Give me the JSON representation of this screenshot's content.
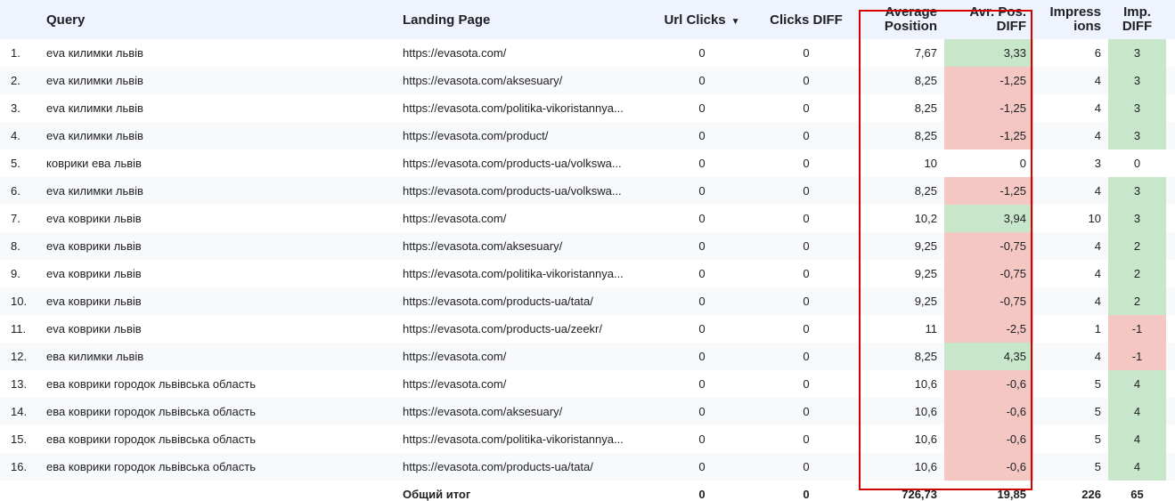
{
  "headers": {
    "query": "Query",
    "landing_page": "Landing Page",
    "url_clicks": "Url Clicks",
    "sort_arrow": "▼",
    "clicks_diff": "Clicks DIFF",
    "avg_position": [
      "Average",
      "Position"
    ],
    "avg_pos_diff": [
      "Avr. Pos.",
      "DIFF"
    ],
    "impressions": [
      "Impress",
      "ions"
    ],
    "imp_diff": [
      "Imp.",
      "DIFF"
    ]
  },
  "rows": [
    {
      "idx": "1.",
      "query": "eva килимки львів",
      "page": "https://evasota.com/",
      "clicks": "0",
      "clicks_diff": "0",
      "avg_pos": "7,67",
      "pos_diff": "3,33",
      "pos_diff_sign": "pos",
      "impr": "6",
      "imp_diff": "3",
      "imp_diff_sign": "pos"
    },
    {
      "idx": "2.",
      "query": "eva килимки львів",
      "page": "https://evasota.com/aksesuary/",
      "clicks": "0",
      "clicks_diff": "0",
      "avg_pos": "8,25",
      "pos_diff": "-1,25",
      "pos_diff_sign": "neg",
      "impr": "4",
      "imp_diff": "3",
      "imp_diff_sign": "pos"
    },
    {
      "idx": "3.",
      "query": "eva килимки львів",
      "page": "https://evasota.com/politika-vikoristannya...",
      "clicks": "0",
      "clicks_diff": "0",
      "avg_pos": "8,25",
      "pos_diff": "-1,25",
      "pos_diff_sign": "neg",
      "impr": "4",
      "imp_diff": "3",
      "imp_diff_sign": "pos"
    },
    {
      "idx": "4.",
      "query": "eva килимки львів",
      "page": "https://evasota.com/product/",
      "clicks": "0",
      "clicks_diff": "0",
      "avg_pos": "8,25",
      "pos_diff": "-1,25",
      "pos_diff_sign": "neg",
      "impr": "4",
      "imp_diff": "3",
      "imp_diff_sign": "pos"
    },
    {
      "idx": "5.",
      "query": "коврики ева львів",
      "page": "https://evasota.com/products-ua/volkswa...",
      "clicks": "0",
      "clicks_diff": "0",
      "avg_pos": "10",
      "pos_diff": "0",
      "pos_diff_sign": "none",
      "impr": "3",
      "imp_diff": "0",
      "imp_diff_sign": "none"
    },
    {
      "idx": "6.",
      "query": "eva килимки львів",
      "page": "https://evasota.com/products-ua/volkswa...",
      "clicks": "0",
      "clicks_diff": "0",
      "avg_pos": "8,25",
      "pos_diff": "-1,25",
      "pos_diff_sign": "neg",
      "impr": "4",
      "imp_diff": "3",
      "imp_diff_sign": "pos"
    },
    {
      "idx": "7.",
      "query": "eva коврики львів",
      "page": "https://evasota.com/",
      "clicks": "0",
      "clicks_diff": "0",
      "avg_pos": "10,2",
      "pos_diff": "3,94",
      "pos_diff_sign": "pos",
      "impr": "10",
      "imp_diff": "3",
      "imp_diff_sign": "pos"
    },
    {
      "idx": "8.",
      "query": "eva коврики львів",
      "page": "https://evasota.com/aksesuary/",
      "clicks": "0",
      "clicks_diff": "0",
      "avg_pos": "9,25",
      "pos_diff": "-0,75",
      "pos_diff_sign": "neg",
      "impr": "4",
      "imp_diff": "2",
      "imp_diff_sign": "pos"
    },
    {
      "idx": "9.",
      "query": "eva коврики львів",
      "page": "https://evasota.com/politika-vikoristannya...",
      "clicks": "0",
      "clicks_diff": "0",
      "avg_pos": "9,25",
      "pos_diff": "-0,75",
      "pos_diff_sign": "neg",
      "impr": "4",
      "imp_diff": "2",
      "imp_diff_sign": "pos"
    },
    {
      "idx": "10.",
      "query": "eva коврики львів",
      "page": "https://evasota.com/products-ua/tata/",
      "clicks": "0",
      "clicks_diff": "0",
      "avg_pos": "9,25",
      "pos_diff": "-0,75",
      "pos_diff_sign": "neg",
      "impr": "4",
      "imp_diff": "2",
      "imp_diff_sign": "pos"
    },
    {
      "idx": "11.",
      "query": "eva коврики львів",
      "page": "https://evasota.com/products-ua/zeekr/",
      "clicks": "0",
      "clicks_diff": "0",
      "avg_pos": "11",
      "pos_diff": "-2,5",
      "pos_diff_sign": "neg",
      "impr": "1",
      "imp_diff": "-1",
      "imp_diff_sign": "neg"
    },
    {
      "idx": "12.",
      "query": "ева килимки львів",
      "page": "https://evasota.com/",
      "clicks": "0",
      "clicks_diff": "0",
      "avg_pos": "8,25",
      "pos_diff": "4,35",
      "pos_diff_sign": "pos",
      "impr": "4",
      "imp_diff": "-1",
      "imp_diff_sign": "neg"
    },
    {
      "idx": "13.",
      "query": "ева коврики городок львівська область",
      "page": "https://evasota.com/",
      "clicks": "0",
      "clicks_diff": "0",
      "avg_pos": "10,6",
      "pos_diff": "-0,6",
      "pos_diff_sign": "neg",
      "impr": "5",
      "imp_diff": "4",
      "imp_diff_sign": "pos"
    },
    {
      "idx": "14.",
      "query": "ева коврики городок львівська область",
      "page": "https://evasota.com/aksesuary/",
      "clicks": "0",
      "clicks_diff": "0",
      "avg_pos": "10,6",
      "pos_diff": "-0,6",
      "pos_diff_sign": "neg",
      "impr": "5",
      "imp_diff": "4",
      "imp_diff_sign": "pos"
    },
    {
      "idx": "15.",
      "query": "ева коврики городок львівська область",
      "page": "https://evasota.com/politika-vikoristannya...",
      "clicks": "0",
      "clicks_diff": "0",
      "avg_pos": "10,6",
      "pos_diff": "-0,6",
      "pos_diff_sign": "neg",
      "impr": "5",
      "imp_diff": "4",
      "imp_diff_sign": "pos"
    },
    {
      "idx": "16.",
      "query": "ева коврики городок львівська область",
      "page": "https://evasota.com/products-ua/tata/",
      "clicks": "0",
      "clicks_diff": "0",
      "avg_pos": "10,6",
      "pos_diff": "-0,6",
      "pos_diff_sign": "neg",
      "impr": "5",
      "imp_diff": "4",
      "imp_diff_sign": "pos"
    }
  ],
  "totals": {
    "label": "Общий итог",
    "clicks": "0",
    "clicks_diff": "0",
    "avg_pos": "726,73",
    "pos_diff": "19,85",
    "impr": "226",
    "imp_diff": "65"
  },
  "colors": {
    "positive": "#c8e6c9",
    "negative": "#f4c7c3",
    "header_bg": "#eef3fd",
    "highlight_border": "#d50000"
  }
}
